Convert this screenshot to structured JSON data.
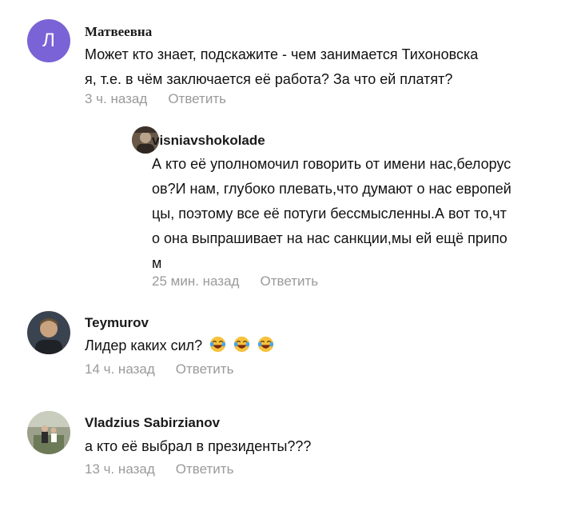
{
  "comments": [
    {
      "author": "Матвеевна",
      "avatar_letter": "Л",
      "avatar_color": "#7a63d6",
      "lines": [
        "Может кто знает, подскажите - чем занимается Тихоновска",
        "я, т.е. в чём заключается её работа? За что ей платят?"
      ],
      "time": "3 ч. назад",
      "reply": "Ответить"
    },
    {
      "author": "visniavshokolade",
      "lines": [
        "А кто её уполномочил говорить от имени нас,белорус",
        "ов?И нам, глубоко плевать,что думают о нас европей",
        "цы, поэтому все её потуги бессмысленны.А вот то,чт",
        "о она выпрашивает на нас санкции,мы ей ещё припо",
        "м"
      ],
      "time": "25 мин. назад",
      "reply": "Ответить"
    },
    {
      "author": "Teymurov",
      "text": "Лидер каких сил?",
      "emoji": "laughing-face-emoji",
      "time": "14 ч. назад",
      "reply": "Ответить"
    },
    {
      "author": "Vladzius Sabirzianov",
      "text": "а кто её выбрал в президенты???",
      "time": "13 ч. назад",
      "reply": "Ответить"
    }
  ]
}
